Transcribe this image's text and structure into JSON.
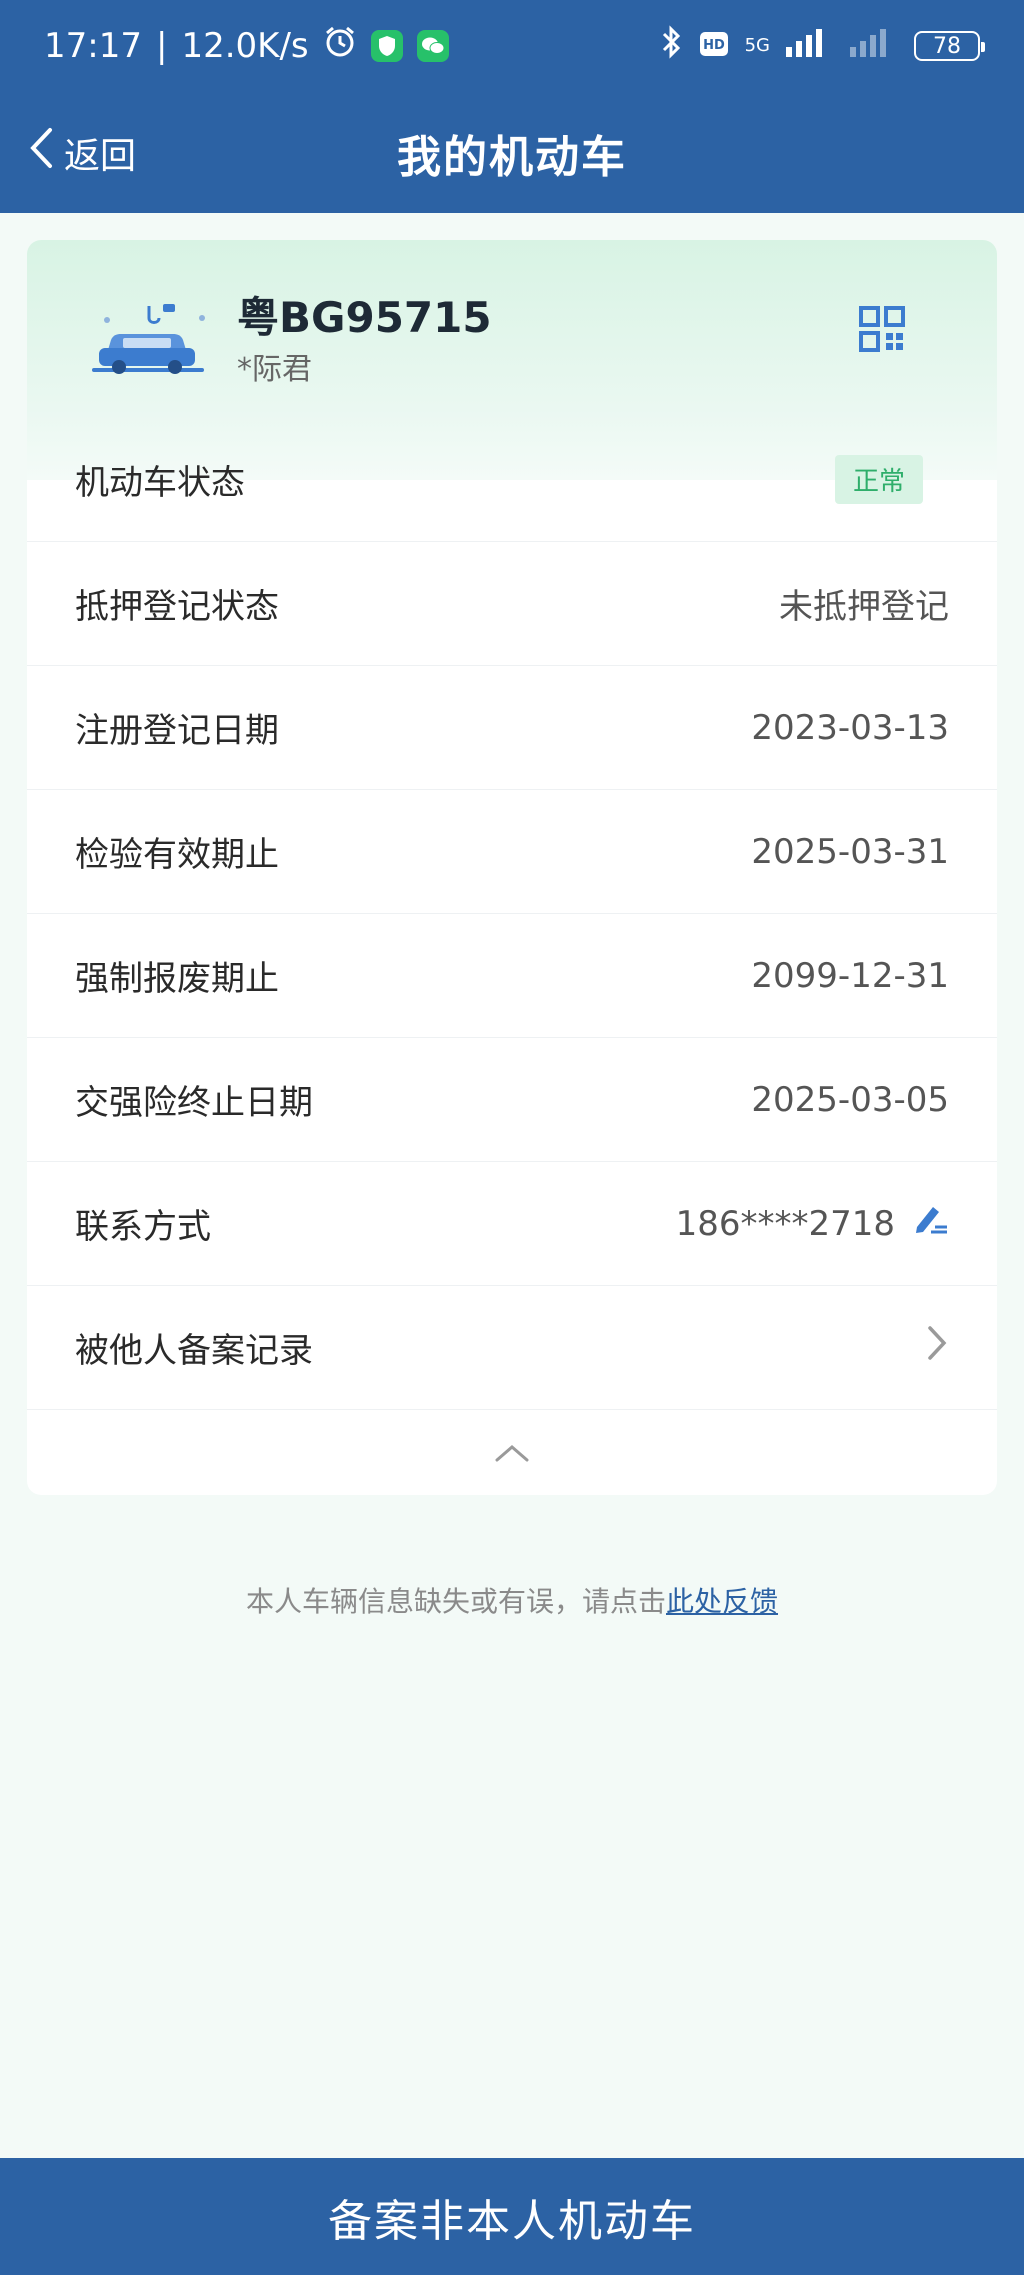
{
  "status_bar": {
    "time": "17:17",
    "speed": "12.0K/s",
    "network": "5G",
    "battery": "78",
    "icons": [
      "alarm-icon",
      "shield-icon",
      "wechat-icon",
      "bluetooth-icon",
      "hd-icon",
      "signal-icon"
    ]
  },
  "nav": {
    "back_label": "返回",
    "title": "我的机动车"
  },
  "vehicle": {
    "plate": "粤BG95715",
    "owner": "*际君",
    "icon": "car-icon",
    "qr_icon": "qr-code-icon"
  },
  "rows": [
    {
      "label": "机动车状态",
      "value": "正常"
    },
    {
      "label": "抵押登记状态",
      "value": "未抵押登记"
    },
    {
      "label": "注册登记日期",
      "value": "2023-03-13"
    },
    {
      "label": "检验有效期止",
      "value": "2025-03-31"
    },
    {
      "label": "强制报废期止",
      "value": "2099-12-31"
    },
    {
      "label": "交强险终止日期",
      "value": "2025-03-05"
    },
    {
      "label": "联系方式",
      "value": "186****2718"
    },
    {
      "label": "被他人备案记录",
      "value": ""
    }
  ],
  "feedback": {
    "text": "本人车辆信息缺失或有误，请点击",
    "link": "此处反馈"
  },
  "bottom_button": "备案非本人机动车",
  "colors": {
    "primary": "#2c62a4",
    "status_green": "#2fae6b",
    "status_bg": "#d8f3e4",
    "page_bg": "#f3faf7"
  }
}
